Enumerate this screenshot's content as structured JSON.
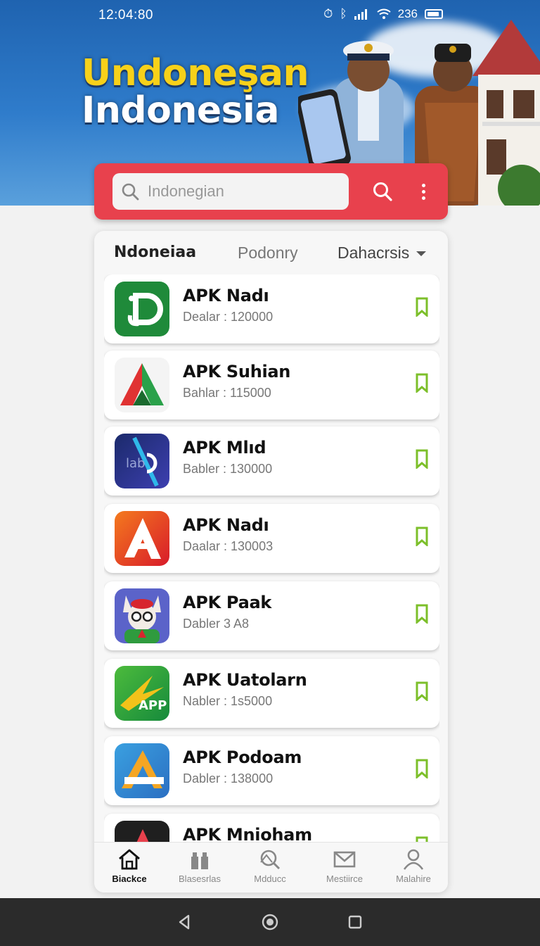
{
  "status_bar": {
    "time": "12:04:80",
    "network": "236"
  },
  "hero": {
    "title_line1": "Undoneşan",
    "title_line2": "Indonesia"
  },
  "search": {
    "placeholder": "Indonegian"
  },
  "tabs": [
    {
      "label": "Ndoneiaa",
      "active": true
    },
    {
      "label": "Podonry",
      "active": false
    },
    {
      "label": "Dahacrsis",
      "active": false,
      "dropdown": true
    }
  ],
  "apps": [
    {
      "name": "APK Nadı",
      "meta": "Dealar : 120000",
      "icon": "jd-green-icon"
    },
    {
      "name": "APK Suhian",
      "meta": "Bahlar : 115000",
      "icon": "triangle-a-icon"
    },
    {
      "name": "APK Mlıd",
      "meta": "Babler : 130000",
      "icon": "lab-blue-icon"
    },
    {
      "name": "APK Nadı",
      "meta": "Daalar : 130003",
      "icon": "a-orange-icon"
    },
    {
      "name": "APK Paak",
      "meta": "Dabler 3 A8",
      "icon": "mascot-icon"
    },
    {
      "name": "APK Uatolarn",
      "meta": "Nabler : 1s5000",
      "icon": "app-green-icon"
    },
    {
      "name": "APK Podoam",
      "meta": "Dabler : 138000",
      "icon": "a-blue-orange-icon"
    },
    {
      "name": "APK Mnioham",
      "meta": "",
      "icon": "a-dark-icon"
    }
  ],
  "bottom_nav": [
    {
      "label": "Biackce",
      "icon": "home-icon",
      "active": true
    },
    {
      "label": "Blasesrlas",
      "icon": "gift-icon",
      "active": false
    },
    {
      "label": "Mdducc",
      "icon": "search-tag-icon",
      "active": false
    },
    {
      "label": "Mestiirce",
      "icon": "mail-icon",
      "active": false
    },
    {
      "label": "Malahire",
      "icon": "user-icon",
      "active": false
    }
  ],
  "colors": {
    "search_bar": "#e8414d",
    "bookmark": "#7cbf2a",
    "hero_blue": "#2f7ccb",
    "title_yellow": "#f7d11a"
  }
}
